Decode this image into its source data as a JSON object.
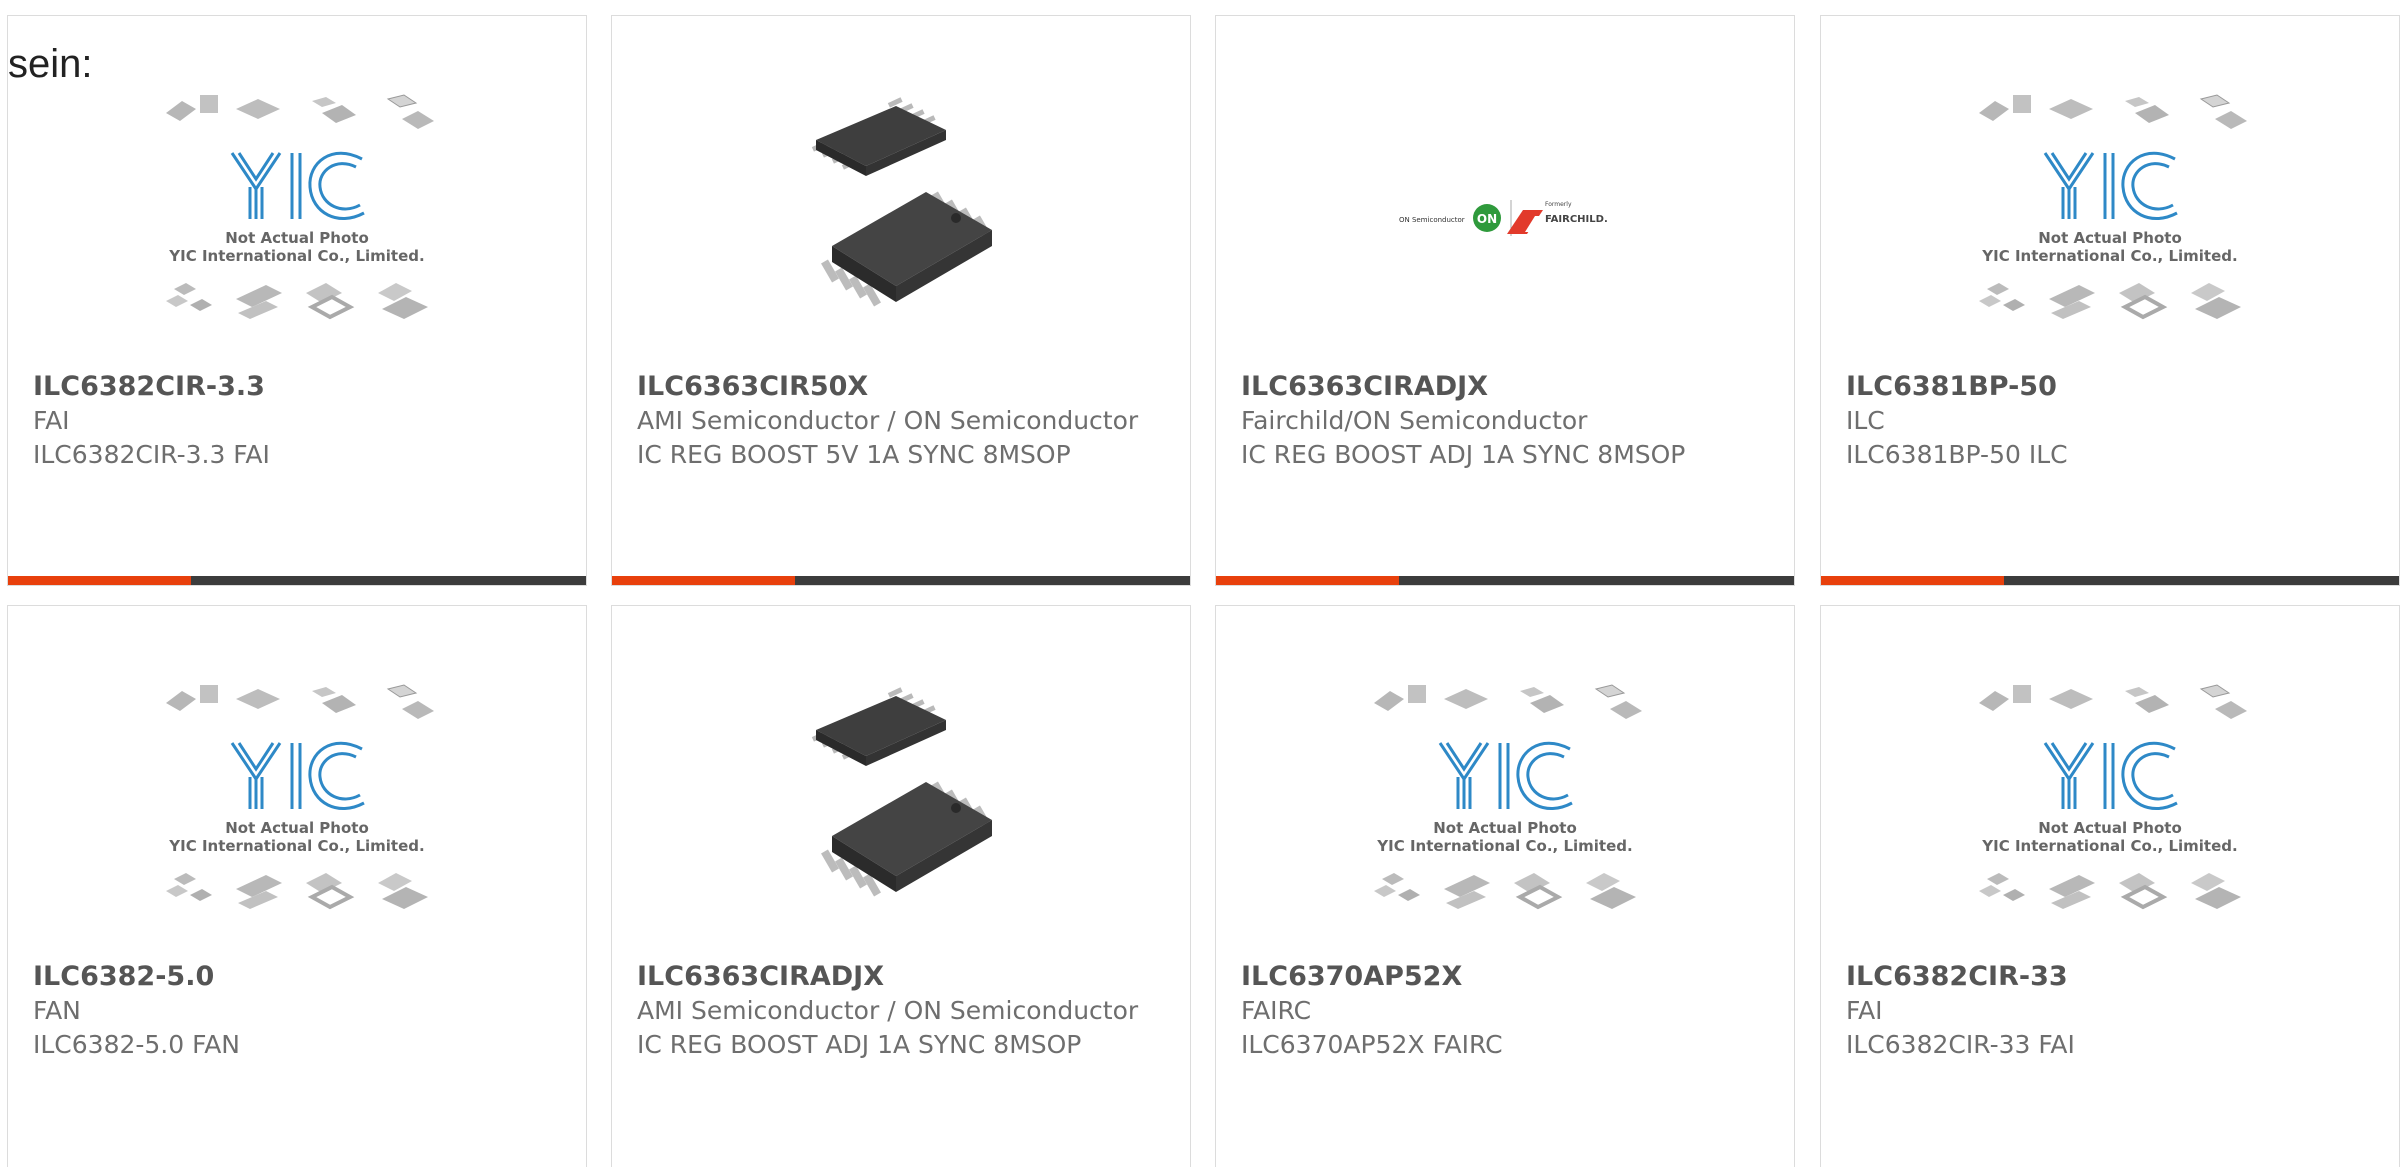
{
  "lead_text": "sein:",
  "colors": {
    "accent": "#e8400c",
    "bar_dark": "#3c3c3c",
    "yic_blue": "#2e89c7"
  },
  "placeholder": {
    "line1": "Not Actual Photo",
    "line2": "YIC International Co., Limited."
  },
  "logo": {
    "brand1": "ON Semiconductor",
    "brand_on": "ON",
    "formerly": "Formerly",
    "brand2": "FAIRCHILD."
  },
  "products": [
    {
      "image": "yic-placeholder",
      "part": "ILC6382CIR-3.3",
      "lines": [
        "FAI",
        "ILC6382CIR-3.3 FAI"
      ]
    },
    {
      "image": "msop-chip",
      "part": "ILC6363CIR50X",
      "lines": [
        "AMI Semiconductor / ON Semiconductor",
        "IC REG BOOST 5V 1A SYNC 8MSOP"
      ]
    },
    {
      "image": "on-fairchild-logo",
      "part": "ILC6363CIRADJX",
      "lines": [
        "Fairchild/ON Semiconductor",
        "IC REG BOOST ADJ 1A SYNC 8MSOP"
      ]
    },
    {
      "image": "yic-placeholder",
      "part": "ILC6381BP-50",
      "lines": [
        "ILC",
        "ILC6381BP-50 ILC"
      ]
    },
    {
      "image": "yic-placeholder",
      "part": "ILC6382-5.0",
      "lines": [
        "FAN",
        "ILC6382-5.0 FAN"
      ]
    },
    {
      "image": "msop-chip",
      "part": "ILC6363CIRADJX",
      "lines": [
        "AMI Semiconductor / ON Semiconductor",
        "IC REG BOOST ADJ 1A SYNC 8MSOP"
      ]
    },
    {
      "image": "yic-placeholder",
      "part": "ILC6370AP52X",
      "lines": [
        "FAIRC",
        "ILC6370AP52X FAIRC"
      ]
    },
    {
      "image": "yic-placeholder",
      "part": "ILC6382CIR-33",
      "lines": [
        "FAI",
        "ILC6382CIR-33 FAI"
      ]
    }
  ]
}
